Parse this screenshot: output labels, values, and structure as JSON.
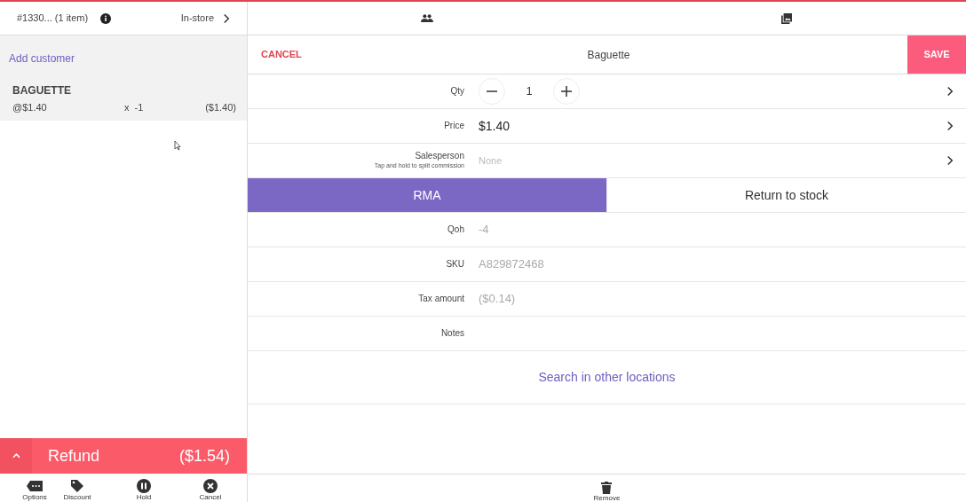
{
  "order_header": {
    "title": "#1330... (1 item)",
    "mode": "In-store"
  },
  "add_customer": "Add customer",
  "cart_items": [
    {
      "name": "BAGUETTE",
      "unit_price": "@$1.40",
      "quantity": "x  -1",
      "total": "($1.40)",
      "selected": true
    }
  ],
  "refund_bar": {
    "label": "Refund",
    "amount": "($1.54)"
  },
  "left_toolbar": [
    {
      "kind": "options",
      "label": "Options"
    },
    {
      "kind": "discount",
      "label": "Discount"
    },
    {
      "kind": "hold",
      "label": "Hold"
    },
    {
      "kind": "cancel",
      "label": "Cancel"
    }
  ],
  "top_tabs": [
    {
      "kind": "customers"
    },
    {
      "kind": "gallery"
    }
  ],
  "editor": {
    "cancel": "CANCEL",
    "title": "Baguette",
    "save": "SAVE"
  },
  "fields": [
    {
      "kind": "stepper",
      "label": "Qty",
      "value": "1",
      "chevron": true
    },
    {
      "kind": "value",
      "label": "Price",
      "value": "$1.40",
      "chevron": true
    },
    {
      "kind": "placeholder",
      "label": "Salesperson",
      "hint": "Tap and hold to split commission",
      "placeholder": "None",
      "chevron": true
    }
  ],
  "return_options": [
    {
      "label": "RMA",
      "selected": true
    },
    {
      "label": "Return to stock",
      "selected": false
    }
  ],
  "details": [
    {
      "label": "Qoh",
      "value": "-4"
    },
    {
      "label": "SKU",
      "value": "A829872468"
    },
    {
      "label": "Tax amount",
      "value": "($0.14)"
    },
    {
      "label": "Notes"
    }
  ],
  "search_link": "Search in other locations",
  "right_toolbar": [
    {
      "kind": "remove",
      "label": "Remove"
    }
  ]
}
